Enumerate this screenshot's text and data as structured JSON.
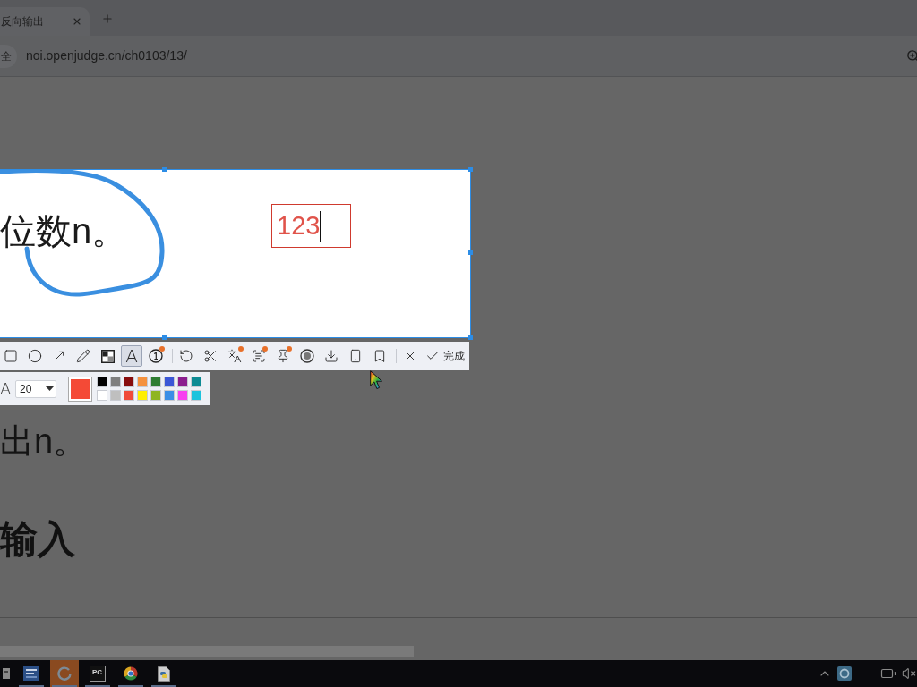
{
  "browser": {
    "tab": {
      "title": "反向输出一"
    },
    "security_chip": "全",
    "url": "noi.openjudge.cn/ch0103/13/"
  },
  "page": {
    "lines": [
      {
        "kind": "text",
        "text": "出n。"
      },
      {
        "kind": "heading",
        "text": "输入"
      }
    ]
  },
  "capture": {
    "text": "位数n。",
    "annotation": "123"
  },
  "toolbar": {
    "groups": [
      {
        "tools": [
          {
            "kind": "rectangle",
            "selected": false,
            "badge": false
          },
          {
            "kind": "ellipse",
            "selected": false,
            "badge": false
          },
          {
            "kind": "arrow",
            "selected": false,
            "badge": false
          },
          {
            "kind": "pencil",
            "selected": false,
            "badge": false
          },
          {
            "kind": "mosaic",
            "selected": false,
            "badge": false
          },
          {
            "kind": "text",
            "glyph": "A",
            "selected": true,
            "badge": false
          },
          {
            "kind": "number",
            "selected": false,
            "badge": true
          }
        ]
      },
      {
        "tools": [
          {
            "kind": "undo",
            "selected": false,
            "badge": false
          },
          {
            "kind": "cutout",
            "selected": false,
            "badge": false
          },
          {
            "kind": "translate",
            "selected": false,
            "badge": true
          },
          {
            "kind": "ocr",
            "selected": false,
            "badge": true
          },
          {
            "kind": "pin",
            "selected": false,
            "badge": true
          },
          {
            "kind": "record",
            "selected": false,
            "badge": false
          },
          {
            "kind": "save",
            "selected": false,
            "badge": false
          },
          {
            "kind": "phone",
            "selected": false,
            "badge": false
          },
          {
            "kind": "bookmark",
            "selected": false,
            "badge": false
          }
        ]
      },
      {
        "tools": [
          {
            "kind": "cancel",
            "selected": false,
            "badge": false
          }
        ]
      }
    ],
    "done": "完成"
  },
  "style_panel": {
    "font_glyph": "A",
    "font_size": "20",
    "current_swatch": {
      "color": "#f44a36"
    },
    "palette": [
      {
        "color": "#000000"
      },
      {
        "color": "#7f7f7f"
      },
      {
        "color": "#880d0d"
      },
      {
        "color": "#f5923e"
      },
      {
        "color": "#2f7d32"
      },
      {
        "color": "#3b57d6"
      },
      {
        "color": "#8b1e8e"
      },
      {
        "color": "#0d8b93"
      },
      {
        "color": "#ffffff"
      },
      {
        "color": "#bfbfbf"
      },
      {
        "color": "#f04b3a"
      },
      {
        "color": "#ffee00"
      },
      {
        "color": "#8fb522"
      },
      {
        "color": "#3a8ee6"
      },
      {
        "color": "#f73ff0"
      },
      {
        "color": "#1cc3dd"
      }
    ]
  },
  "taskbar": {
    "apps": [
      {
        "kind": "cut-off",
        "active": false,
        "running": false
      },
      {
        "kind": "tile",
        "active": false,
        "running": true
      },
      {
        "kind": "ring",
        "active": true,
        "running": true
      },
      {
        "kind": "ide",
        "label": "PC",
        "active": false,
        "running": true
      },
      {
        "kind": "browser",
        "active": false,
        "running": true
      },
      {
        "kind": "file",
        "active": false,
        "running": true
      }
    ]
  }
}
